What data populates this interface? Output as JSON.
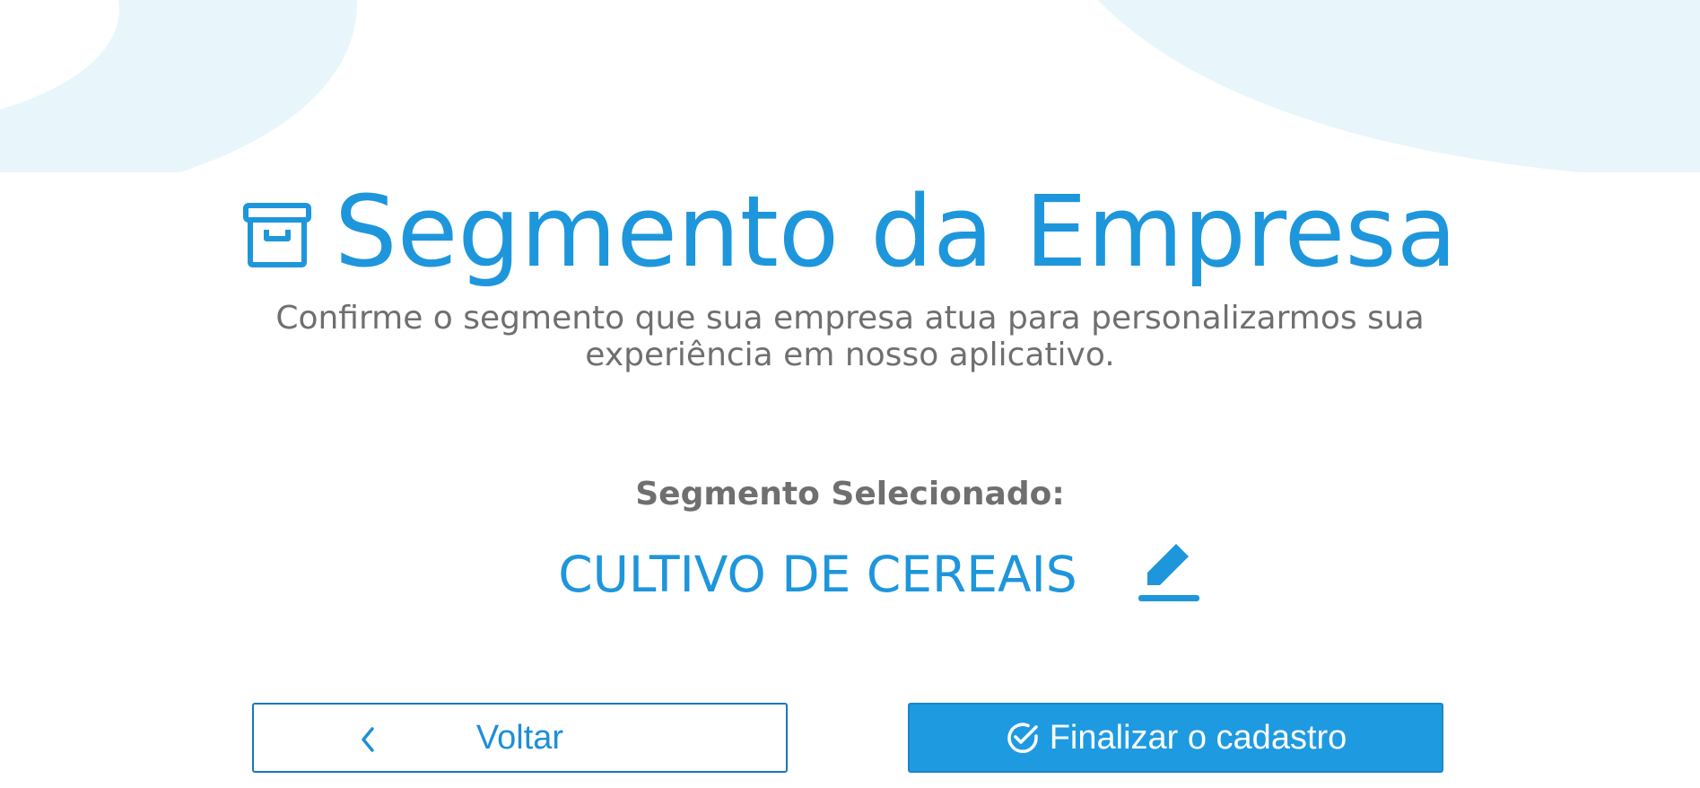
{
  "header": {
    "title": "Segmento da Empresa",
    "icon": "archive-box-icon",
    "subtitle": "Confirme o segmento que sua empresa atua para personalizarmos sua experiência em nosso aplicativo."
  },
  "segment": {
    "label": "Segmento Selecionado:",
    "value": "CULTIVO DE CEREAIS",
    "edit_icon": "pencil-edit-icon"
  },
  "actions": {
    "back_label": "Voltar",
    "back_icon": "chevron-left-icon",
    "finish_label": "Finalizar o cadastro",
    "finish_icon": "check-circle-icon"
  },
  "colors": {
    "primary": "#1e96dc",
    "text_gray": "#6f6f6f",
    "background_shape": "#e8f6fc"
  }
}
